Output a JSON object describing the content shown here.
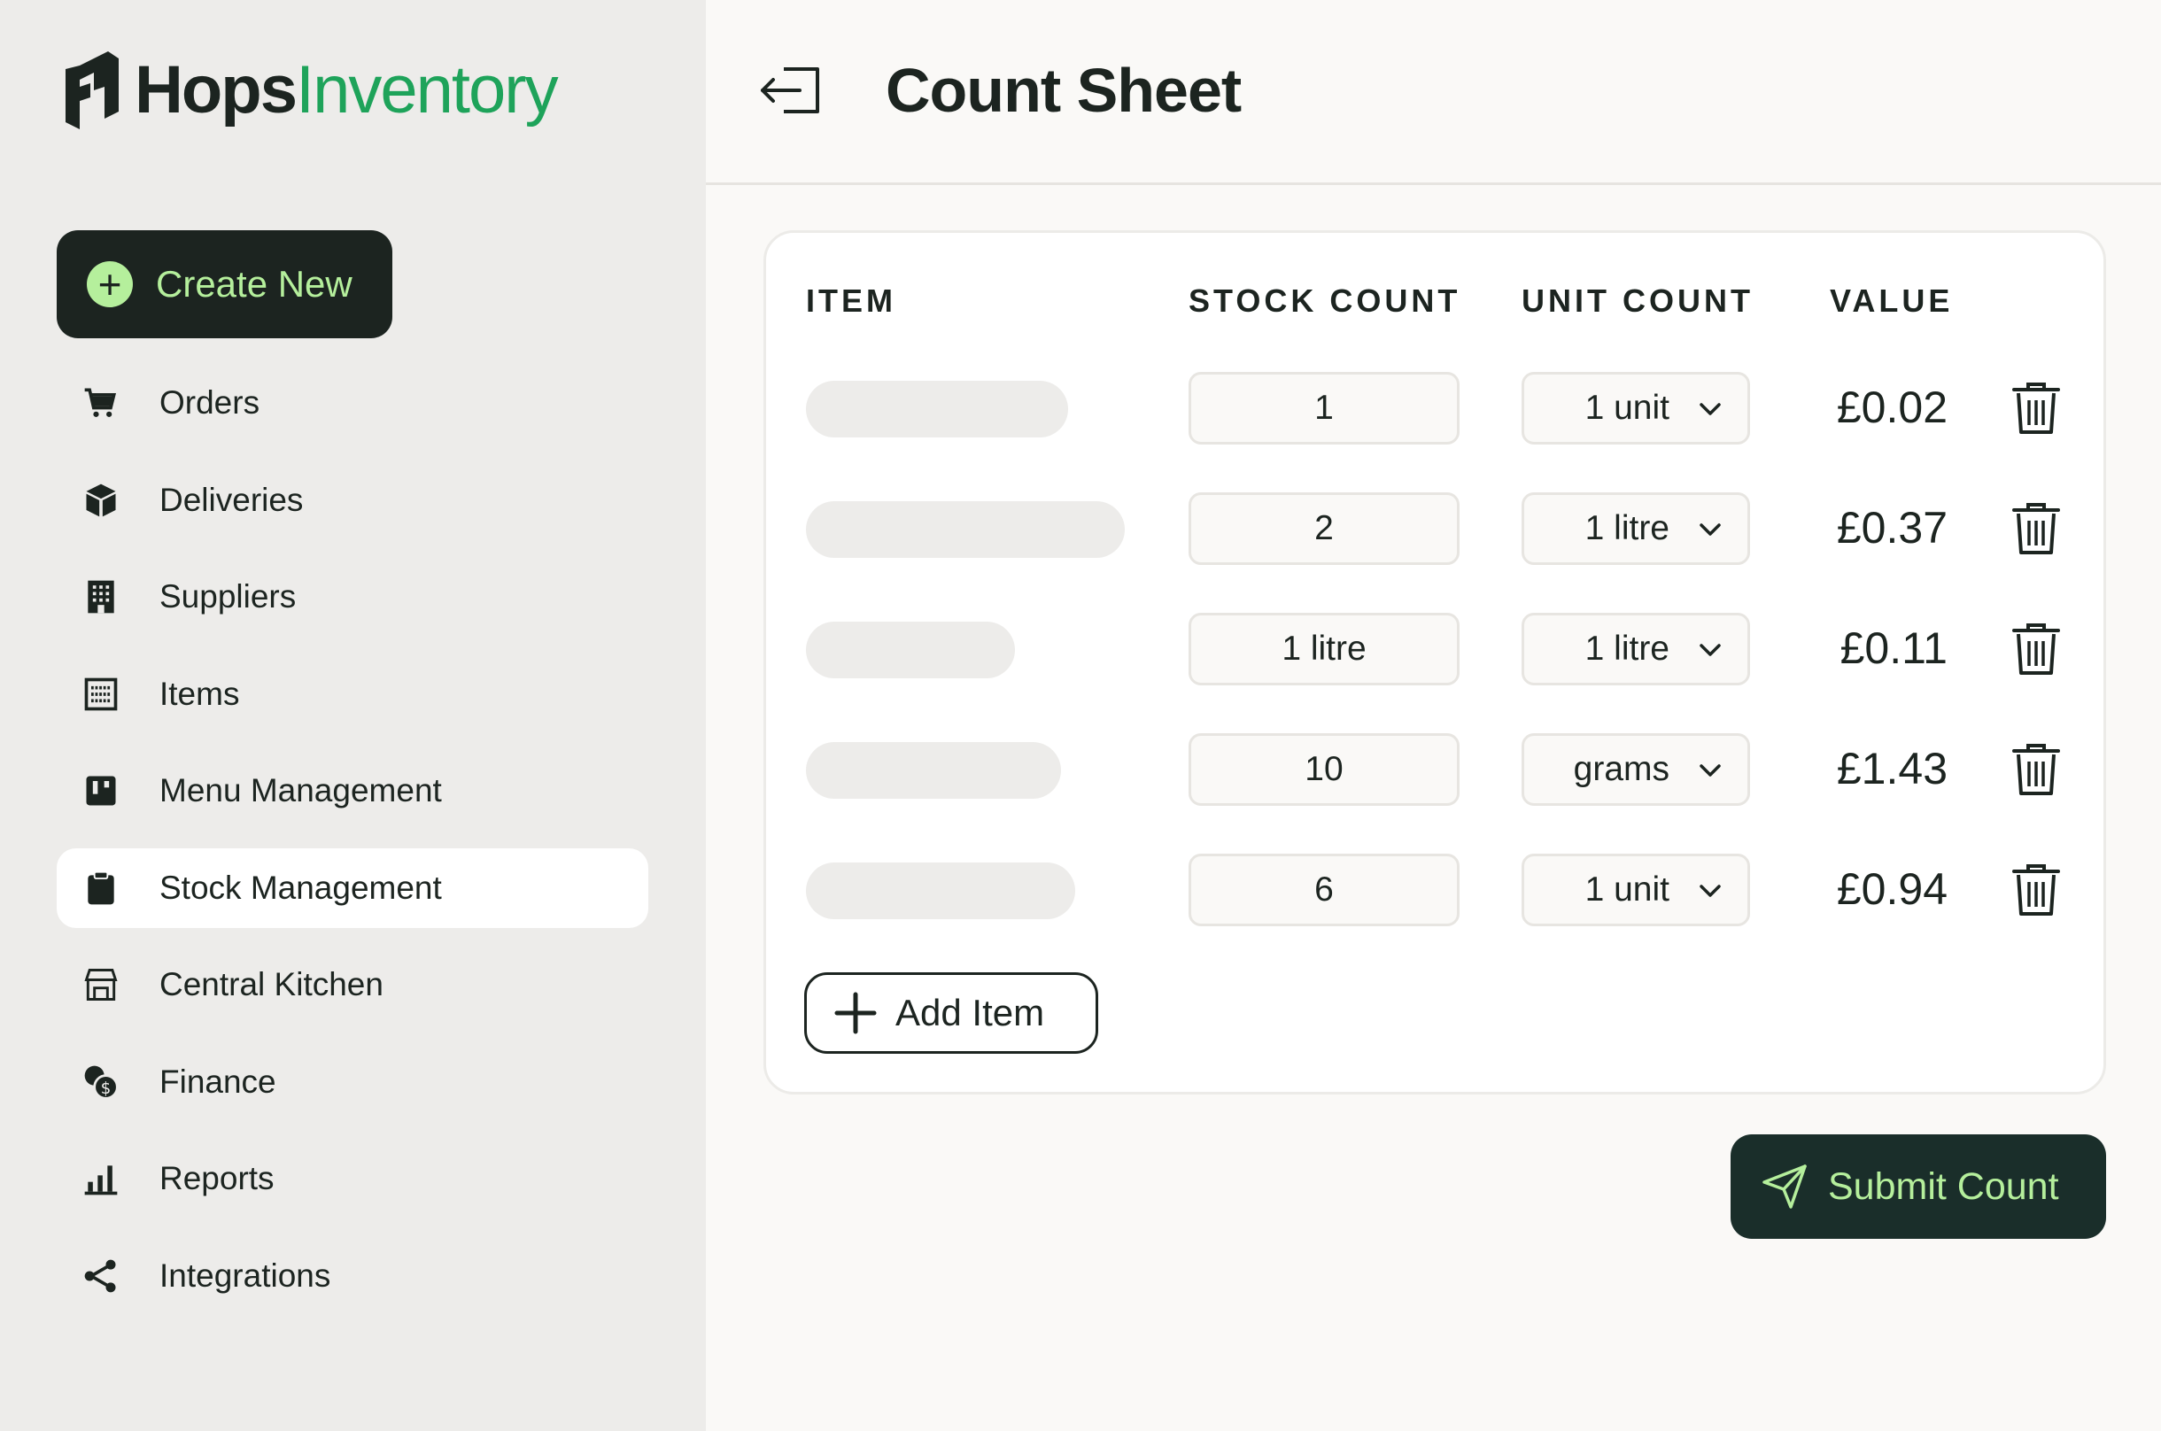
{
  "app": {
    "brand_primary": "Hops",
    "brand_secondary": "Inventory"
  },
  "colors": {
    "accent": "#b5ef9c",
    "brand_green": "#1ea35a",
    "dark": "#1c2420"
  },
  "sidebar": {
    "create_label": "Create New",
    "items": [
      {
        "label": "Orders",
        "icon": "cart-icon"
      },
      {
        "label": "Deliveries",
        "icon": "box-icon"
      },
      {
        "label": "Suppliers",
        "icon": "building-icon"
      },
      {
        "label": "Items",
        "icon": "list-icon"
      },
      {
        "label": "Menu Management",
        "icon": "menu-icon"
      },
      {
        "label": "Stock Management",
        "icon": "clipboard-icon",
        "active": true
      },
      {
        "label": "Central Kitchen",
        "icon": "store-icon"
      },
      {
        "label": "Finance",
        "icon": "coins-icon"
      },
      {
        "label": "Reports",
        "icon": "bar-chart-icon"
      },
      {
        "label": "Integrations",
        "icon": "share-icon"
      }
    ]
  },
  "header": {
    "title": "Count Sheet"
  },
  "table": {
    "headers": {
      "item": "ITEM",
      "stock": "STOCK COUNT",
      "unit": "UNIT COUNT",
      "value": "VALUE"
    },
    "rows": [
      {
        "stock": "1",
        "unit": "1 unit",
        "value": "£0.02"
      },
      {
        "stock": "2",
        "unit": "1 litre",
        "value": "£0.37"
      },
      {
        "stock": "1 litre",
        "unit": "1 litre",
        "value": "£0.11"
      },
      {
        "stock": "10",
        "unit": "grams",
        "value": "£1.43"
      },
      {
        "stock": "6",
        "unit": "1 unit",
        "value": "£0.94"
      }
    ]
  },
  "actions": {
    "add_item": "Add Item",
    "submit": "Submit Count"
  }
}
